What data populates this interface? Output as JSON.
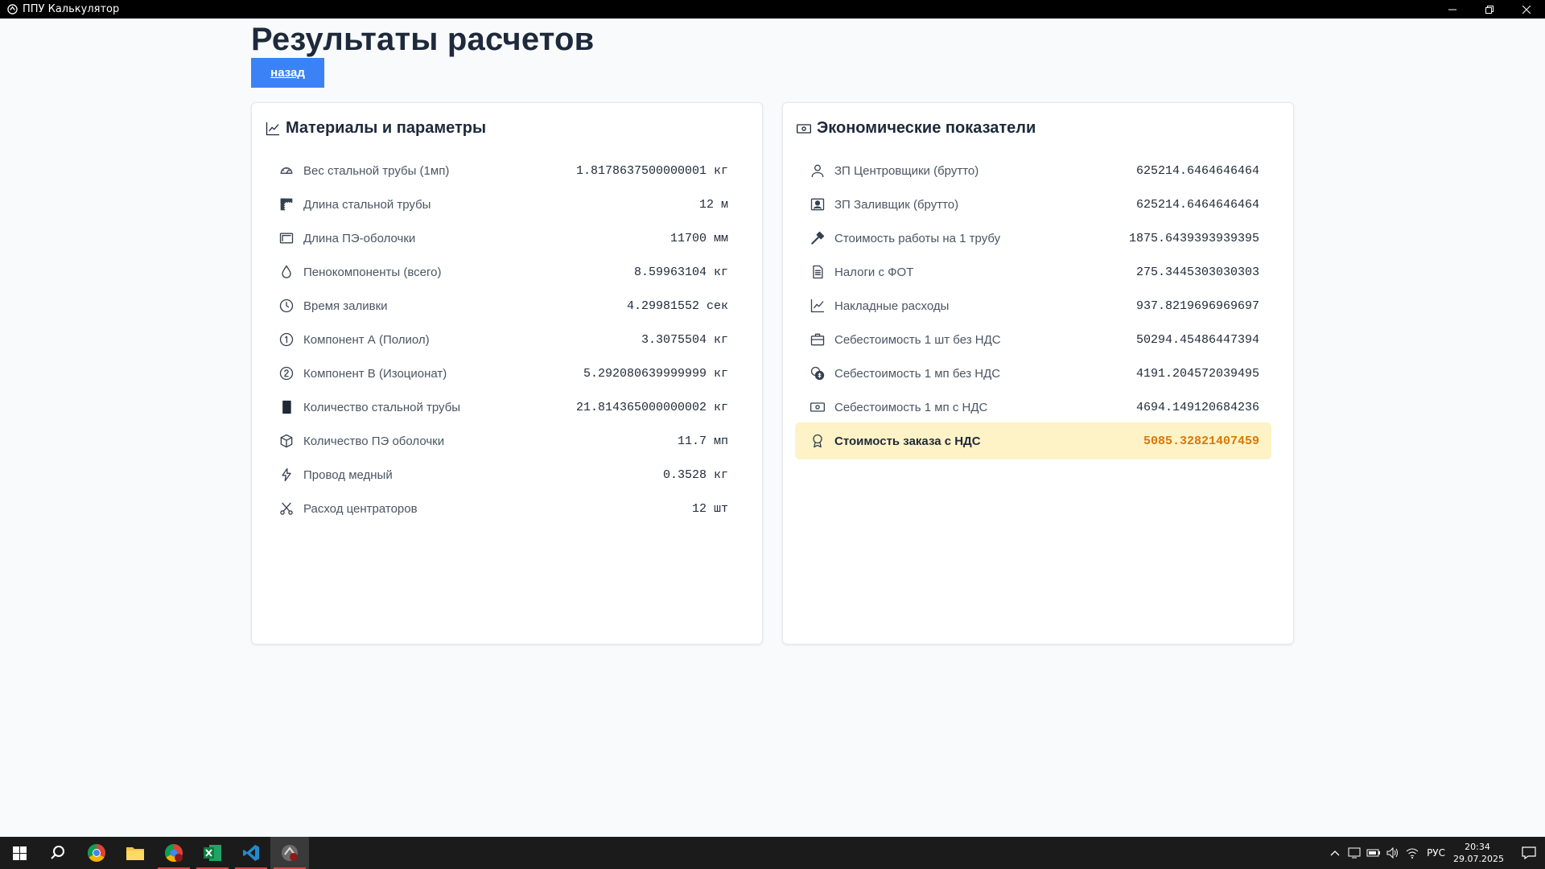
{
  "window": {
    "title": "ППУ Калькулятор"
  },
  "page": {
    "title": "Результаты расчетов",
    "back_label": "назад"
  },
  "materials": {
    "title": "Материалы и параметры",
    "rows": [
      {
        "icon": "gauge-icon",
        "label": "Вес стальной трубы (1мп)",
        "value": "1.8178637500000001 кг"
      },
      {
        "icon": "ruler-icon",
        "label": "Длина стальной трубы",
        "value": "12 м"
      },
      {
        "icon": "frame-icon",
        "label": "Длина ПЭ-оболочки",
        "value": "11700 мм"
      },
      {
        "icon": "droplet-icon",
        "label": "Пенокомпоненты (всего)",
        "value": "8.59963104 кг"
      },
      {
        "icon": "clock-icon",
        "label": "Время заливки",
        "value": "4.29981552 сек"
      },
      {
        "icon": "number-one-icon",
        "label": "Компонент А (Полиол)",
        "value": "3.3075504 кг"
      },
      {
        "icon": "number-two-icon",
        "label": "Компонент В (Изоционат)",
        "value": "5.292080639999999 кг"
      },
      {
        "icon": "black-rectangle-icon",
        "label": "Количество стальной трубы",
        "value": "21.814365000000002 кг"
      },
      {
        "icon": "box-icon",
        "label": "Количество ПЭ оболочки",
        "value": "11.7 мп"
      },
      {
        "icon": "lightning-icon",
        "label": "Провод медный",
        "value": "0.3528 кг"
      },
      {
        "icon": "scissors-icon",
        "label": "Расход центраторов",
        "value": "12 шт"
      }
    ]
  },
  "economics": {
    "title": "Экономические показатели",
    "rows": [
      {
        "icon": "user-icon",
        "label": "ЗП Центровщики (брутто)",
        "value": "625214.6464646464"
      },
      {
        "icon": "user-badge-icon",
        "label": "ЗП Заливщик (брутто)",
        "value": "625214.6464646464"
      },
      {
        "icon": "hammer-icon",
        "label": "Стоимость работы на 1 трубу",
        "value": "1875.6439393939395"
      },
      {
        "icon": "document-icon",
        "label": "Налоги с ФОТ",
        "value": "275.3445303030303"
      },
      {
        "icon": "chart-line-icon",
        "label": "Накладные расходы",
        "value": "937.8219696969697"
      },
      {
        "icon": "briefcase-icon",
        "label": "Себестоимость 1 шт без НДС",
        "value": "50294.45486447394"
      },
      {
        "icon": "coins-icon",
        "label": "Себестоимость 1 мп без НДС",
        "value": "4191.204572039495"
      },
      {
        "icon": "banknote-icon",
        "label": "Себестоимость 1 мп с НДС",
        "value": "4694.149120684236"
      },
      {
        "icon": "award-icon",
        "label": "Стоимость заказа с НДС",
        "value": "5085.32821407459"
      }
    ]
  },
  "taskbar": {
    "apps": [
      "windows-start-icon",
      "search-icon",
      "chrome-icon",
      "file-explorer-icon",
      "chrome-profile-icon",
      "excel-icon",
      "vscode-icon",
      "app-icon"
    ],
    "language": "РУС",
    "time": "20:34",
    "date": "29.07.2025"
  }
}
